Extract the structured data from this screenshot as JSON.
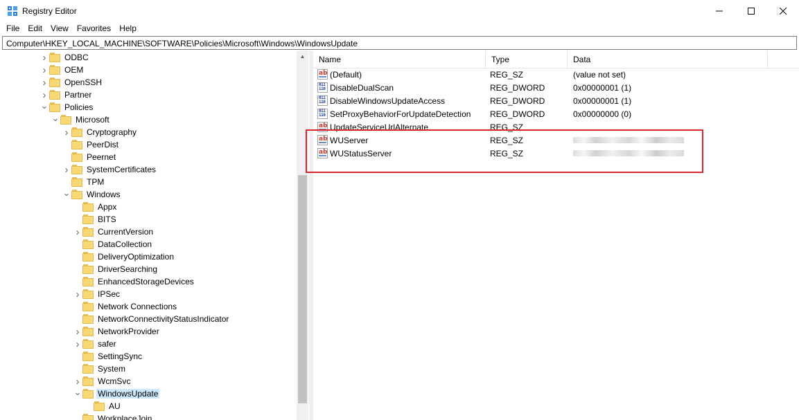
{
  "window": {
    "title": "Registry Editor"
  },
  "controls": {
    "minimize": "—",
    "maximize": "☐",
    "close": "✕"
  },
  "menu": [
    "File",
    "Edit",
    "View",
    "Favorites",
    "Help"
  ],
  "address": "Computer\\HKEY_LOCAL_MACHINE\\SOFTWARE\\Policies\\Microsoft\\Windows\\WindowsUpdate",
  "tree": [
    {
      "label": "ODBC",
      "expander": "right",
      "depth": 0
    },
    {
      "label": "OEM",
      "expander": "right",
      "depth": 0
    },
    {
      "label": "OpenSSH",
      "expander": "right",
      "depth": 0
    },
    {
      "label": "Partner",
      "expander": "right",
      "depth": 0
    },
    {
      "label": "Policies",
      "expander": "down",
      "depth": 0
    },
    {
      "label": "Microsoft",
      "expander": "down",
      "depth": 1
    },
    {
      "label": "Cryptography",
      "expander": "right",
      "depth": 2
    },
    {
      "label": "PeerDist",
      "expander": "none",
      "depth": 2
    },
    {
      "label": "Peernet",
      "expander": "none",
      "depth": 2
    },
    {
      "label": "SystemCertificates",
      "expander": "right",
      "depth": 2
    },
    {
      "label": "TPM",
      "expander": "none",
      "depth": 2
    },
    {
      "label": "Windows",
      "expander": "down",
      "depth": 2
    },
    {
      "label": "Appx",
      "expander": "none",
      "depth": 3
    },
    {
      "label": "BITS",
      "expander": "none",
      "depth": 3
    },
    {
      "label": "CurrentVersion",
      "expander": "right",
      "depth": 3
    },
    {
      "label": "DataCollection",
      "expander": "none",
      "depth": 3
    },
    {
      "label": "DeliveryOptimization",
      "expander": "none",
      "depth": 3
    },
    {
      "label": "DriverSearching",
      "expander": "none",
      "depth": 3
    },
    {
      "label": "EnhancedStorageDevices",
      "expander": "none",
      "depth": 3
    },
    {
      "label": "IPSec",
      "expander": "right",
      "depth": 3
    },
    {
      "label": "Network Connections",
      "expander": "none",
      "depth": 3
    },
    {
      "label": "NetworkConnectivityStatusIndicator",
      "expander": "none",
      "depth": 3
    },
    {
      "label": "NetworkProvider",
      "expander": "right",
      "depth": 3
    },
    {
      "label": "safer",
      "expander": "right",
      "depth": 3
    },
    {
      "label": "SettingSync",
      "expander": "none",
      "depth": 3
    },
    {
      "label": "System",
      "expander": "none",
      "depth": 3
    },
    {
      "label": "WcmSvc",
      "expander": "right",
      "depth": 3
    },
    {
      "label": "WindowsUpdate",
      "expander": "down",
      "depth": 3,
      "selected": true
    },
    {
      "label": "AU",
      "expander": "none",
      "depth": 4
    },
    {
      "label": "WorkplaceJoin",
      "expander": "none",
      "depth": 3
    }
  ],
  "columns": {
    "name": "Name",
    "type": "Type",
    "data": "Data"
  },
  "values": [
    {
      "name": "(Default)",
      "type": "REG_SZ",
      "data": "(value not set)",
      "icon": "string-value-icon"
    },
    {
      "name": "DisableDualScan",
      "type": "REG_DWORD",
      "data": "0x00000001 (1)",
      "icon": "binary-value-icon"
    },
    {
      "name": "DisableWindowsUpdateAccess",
      "type": "REG_DWORD",
      "data": "0x00000001 (1)",
      "icon": "binary-value-icon"
    },
    {
      "name": "SetProxyBehaviorForUpdateDetection",
      "type": "REG_DWORD",
      "data": "0x00000000 (0)",
      "icon": "binary-value-icon"
    },
    {
      "name": "UpdateServiceUrlAlternate",
      "type": "REG_SZ",
      "data": "",
      "icon": "string-value-icon"
    },
    {
      "name": "WUServer",
      "type": "REG_SZ",
      "data": "",
      "icon": "string-value-icon",
      "redacted": true
    },
    {
      "name": "WUStatusServer",
      "type": "REG_SZ",
      "data": "",
      "icon": "string-value-icon",
      "redacted": true
    }
  ],
  "colors": {
    "highlight_box": "#d8262e",
    "selection": "#cce8ff",
    "folder": "#f8d775"
  }
}
